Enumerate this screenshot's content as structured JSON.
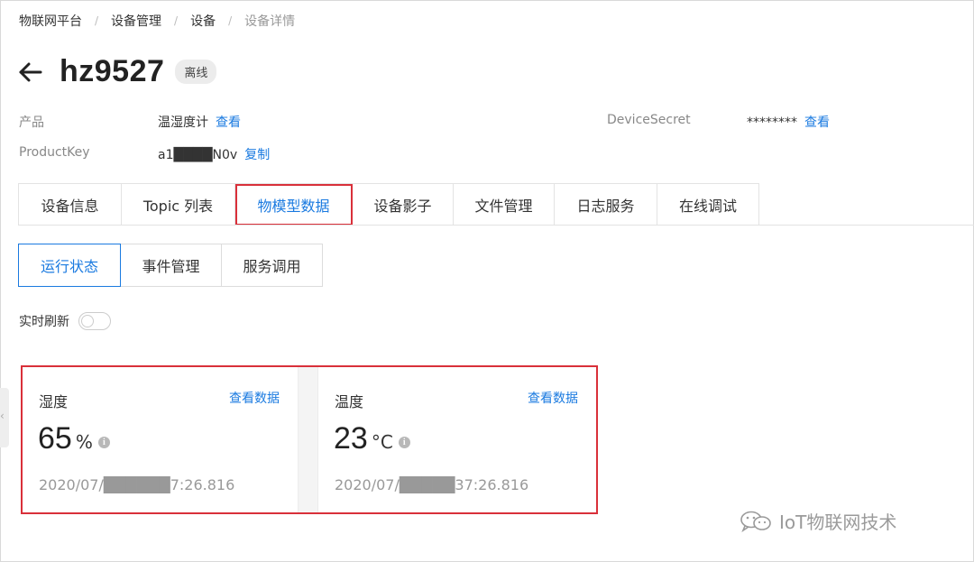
{
  "breadcrumb": {
    "items": [
      "物联网平台",
      "设备管理",
      "设备",
      "设备详情"
    ],
    "separator": "/"
  },
  "header": {
    "title": "hz9527",
    "status": "离线"
  },
  "info": {
    "product_label": "产品",
    "product_value": "温湿度计",
    "product_link": "查看",
    "productkey_label": "ProductKey",
    "productkey_value": "a1████N0v",
    "productkey_link": "复制",
    "secret_label": "DeviceSecret",
    "secret_value": "********",
    "secret_link": "查看"
  },
  "tabs": [
    {
      "label": "设备信息",
      "active": false
    },
    {
      "label": "Topic 列表",
      "active": false
    },
    {
      "label": "物模型数据",
      "active": true
    },
    {
      "label": "设备影子",
      "active": false
    },
    {
      "label": "文件管理",
      "active": false
    },
    {
      "label": "日志服务",
      "active": false
    },
    {
      "label": "在线调试",
      "active": false
    }
  ],
  "subtabs": [
    {
      "label": "运行状态",
      "active": true
    },
    {
      "label": "事件管理",
      "active": false
    },
    {
      "label": "服务调用",
      "active": false
    }
  ],
  "realtime": {
    "label": "实时刷新",
    "enabled": false
  },
  "cards": [
    {
      "name": "湿度",
      "link": "查看数据",
      "value": "65",
      "unit": "%",
      "time": "2020/07/██████7:26.816"
    },
    {
      "name": "温度",
      "link": "查看数据",
      "value": "23",
      "unit": "°C",
      "time": "2020/07/█████37:26.816"
    }
  ],
  "watermark": {
    "text": "IoT物联网技术",
    "icon": "wechat-icon"
  },
  "colors": {
    "accent": "#1a7ae0",
    "highlight": "#d9303a"
  }
}
